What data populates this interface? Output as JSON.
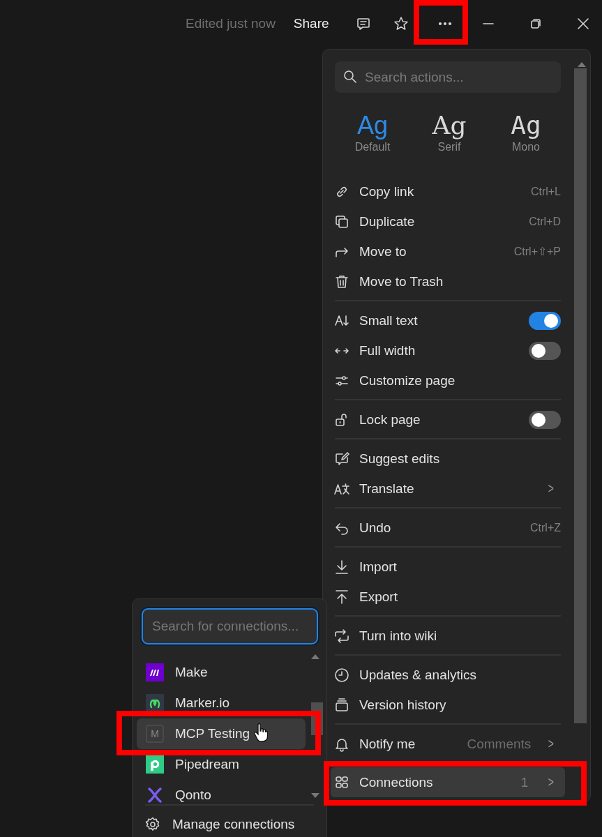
{
  "top_bar": {
    "status": "Edited just now",
    "share": "Share"
  },
  "actions_menu": {
    "search": {
      "placeholder": "Search actions..."
    },
    "fonts": [
      {
        "sample": "Ag",
        "label": "Default",
        "selected": true
      },
      {
        "sample": "Ag",
        "label": "Serif",
        "selected": false
      },
      {
        "sample": "Ag",
        "label": "Mono",
        "selected": false
      }
    ],
    "sections": [
      [
        {
          "kind": "action",
          "label": "Copy link",
          "shortcut": "Ctrl+L"
        },
        {
          "kind": "action",
          "label": "Duplicate",
          "shortcut": "Ctrl+D"
        },
        {
          "kind": "action",
          "label": "Move to",
          "shortcut": "Ctrl+⇧+P"
        },
        {
          "kind": "action",
          "label": "Move to Trash"
        }
      ],
      [
        {
          "kind": "toggle",
          "label": "Small text",
          "on": true
        },
        {
          "kind": "toggle",
          "label": "Full width",
          "on": false
        },
        {
          "kind": "action",
          "label": "Customize page"
        }
      ],
      [
        {
          "kind": "toggle",
          "label": "Lock page",
          "on": false
        }
      ],
      [
        {
          "kind": "action",
          "label": "Suggest edits"
        },
        {
          "kind": "submenu",
          "label": "Translate",
          "chevron": ">"
        }
      ],
      [
        {
          "kind": "action",
          "label": "Undo",
          "shortcut": "Ctrl+Z"
        }
      ],
      [
        {
          "kind": "action",
          "label": "Import"
        },
        {
          "kind": "action",
          "label": "Export"
        }
      ],
      [
        {
          "kind": "action",
          "label": "Turn into wiki"
        }
      ],
      [
        {
          "kind": "action",
          "label": "Updates & analytics"
        },
        {
          "kind": "action",
          "label": "Version history"
        }
      ],
      [
        {
          "kind": "submenu",
          "label": "Notify me",
          "value": "Comments",
          "chevron": ">",
          "hovered": false
        },
        {
          "kind": "submenu",
          "label": "Connections",
          "value": "1",
          "chevron": ">",
          "hovered": true
        }
      ]
    ]
  },
  "connections_menu": {
    "search": {
      "placeholder": "Search for connections..."
    },
    "items": [
      {
        "label": "Make",
        "hovered": false
      },
      {
        "label": "Marker.io",
        "hovered": false
      },
      {
        "label": "MCP Testing",
        "icon_letter": "M",
        "hovered": true
      },
      {
        "label": "Pipedream",
        "hovered": false
      },
      {
        "label": "Qonto",
        "hovered": false
      }
    ],
    "footer": "Manage connections"
  }
}
